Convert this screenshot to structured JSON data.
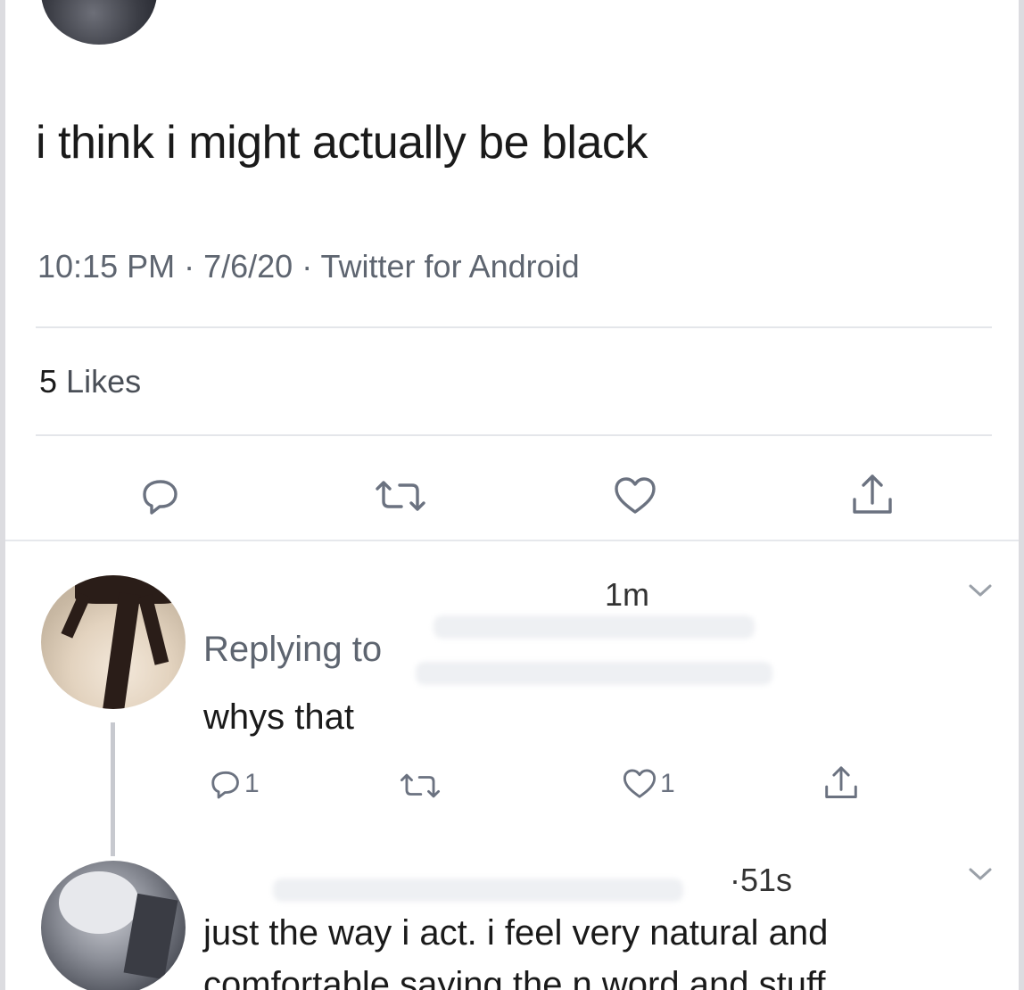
{
  "tweet": {
    "text": "i think i might actually be black",
    "time": "10:15 PM",
    "date": "7/6/20",
    "source": "Twitter for Android",
    "likes_count": "5",
    "likes_label": "Likes"
  },
  "replies": [
    {
      "time": "1m",
      "replying_label": "Replying to",
      "text": "whys that",
      "reply_count": "1",
      "like_count": "1"
    },
    {
      "time": "·51s",
      "text": "just the way i act. i feel very natural and",
      "text_line2": "comfortable saying the n word and stuff"
    }
  ],
  "icons": {
    "reply": "reply-icon",
    "retweet": "retweet-icon",
    "like": "heart-icon",
    "share": "share-icon",
    "more": "chevron-down-icon"
  },
  "colors": {
    "text": "#1a1a1a",
    "muted": "#5e6570",
    "icon": "#6b7280",
    "divider": "#e4e6ea"
  }
}
